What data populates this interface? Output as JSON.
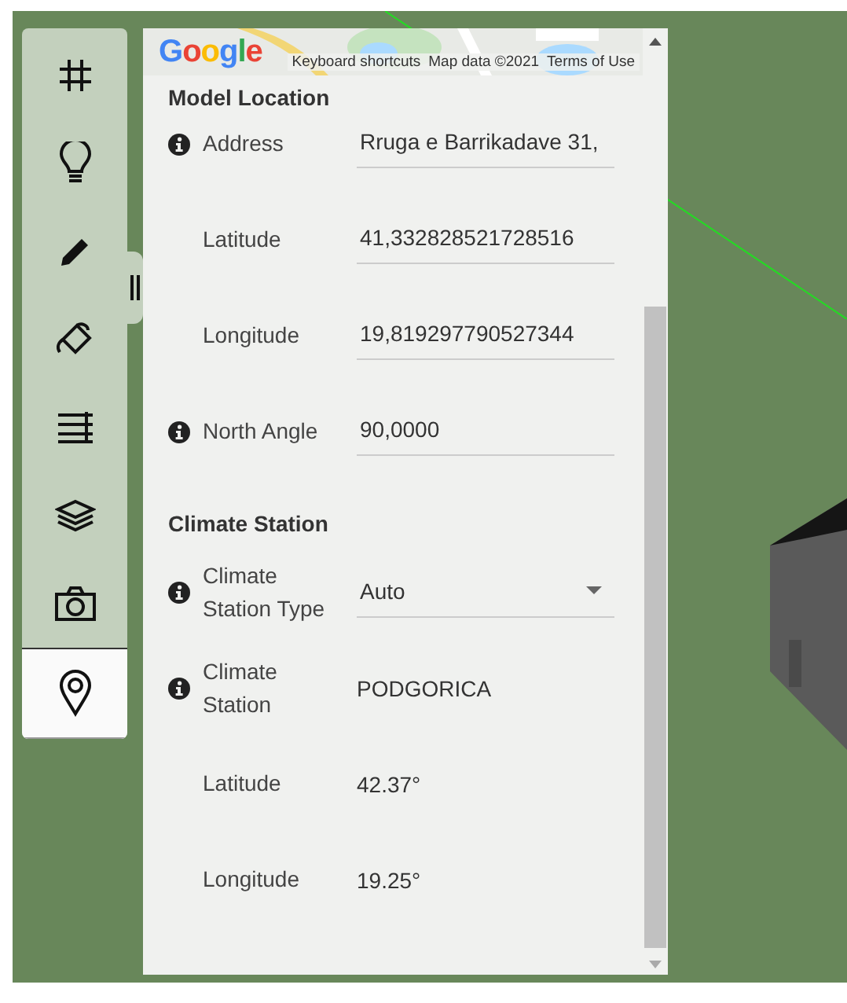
{
  "toolbar": {
    "tools": [
      {
        "kind": "grid",
        "selected": false
      },
      {
        "kind": "bulb",
        "selected": false
      },
      {
        "kind": "pencil",
        "selected": false
      },
      {
        "kind": "bucket",
        "selected": false
      },
      {
        "kind": "lines",
        "selected": false
      },
      {
        "kind": "layers",
        "selected": false
      },
      {
        "kind": "camera",
        "selected": false
      },
      {
        "kind": "pin",
        "selected": true
      }
    ]
  },
  "map": {
    "logo": "Google",
    "links": [
      "Keyboard shortcuts",
      "Map data ©2021",
      "Terms of Use"
    ]
  },
  "sections": [
    {
      "title": "Model Location",
      "fields": [
        {
          "label": "Address",
          "info": true,
          "kind": "input",
          "value": "Rruga e Barrikadave 31,"
        },
        {
          "label": "Latitude",
          "info": false,
          "kind": "input",
          "value": "41,332828521728516"
        },
        {
          "label": "Longitude",
          "info": false,
          "kind": "input",
          "value": "19,819297790527344"
        },
        {
          "label": "North Angle",
          "info": true,
          "kind": "input",
          "value": "90,0000"
        }
      ]
    },
    {
      "title": "Climate Station",
      "fields": [
        {
          "label": "Climate Station Type",
          "info": true,
          "kind": "select",
          "value": "Auto"
        },
        {
          "label": "Climate Station",
          "info": true,
          "kind": "text",
          "value": "PODGORICA"
        },
        {
          "label": "Latitude",
          "info": false,
          "kind": "text",
          "value": "42.37°"
        },
        {
          "label": "Longitude",
          "info": false,
          "kind": "text",
          "value": "19.25°"
        }
      ]
    }
  ]
}
